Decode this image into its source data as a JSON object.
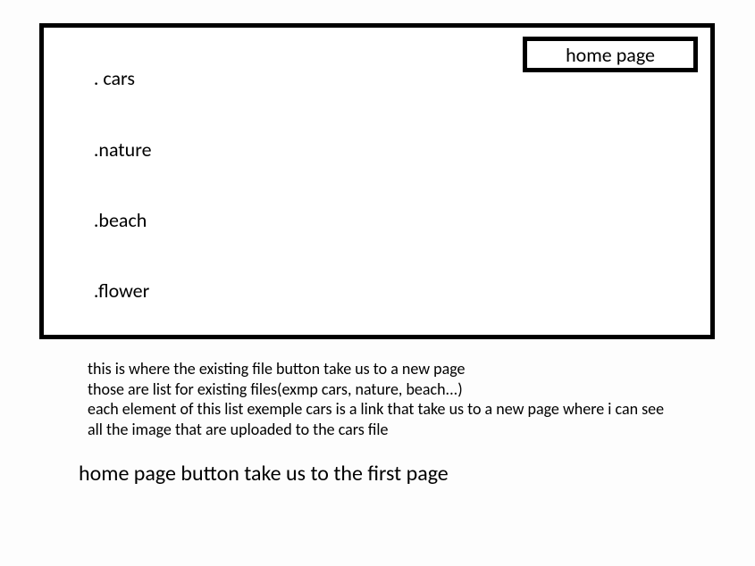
{
  "box": {
    "files": [
      {
        "prefix": ". ",
        "label": "cars"
      },
      {
        "prefix": ".",
        "label": "nature"
      },
      {
        "prefix": ".",
        "label": "beach"
      },
      {
        "prefix": ".",
        "label": "flower"
      }
    ],
    "home_button_label": "home page"
  },
  "description": {
    "line1": "this is where the existing file button take us to a new page",
    "line2": "those are list for existing files(exmp cars, nature, beach...)",
    "line3": "each element of this list exemple cars is a link that take us to a new page  where i can see",
    "line4": "all the image that are uploaded to the cars file"
  },
  "footer": {
    "text": "home page button take us to the first page"
  }
}
